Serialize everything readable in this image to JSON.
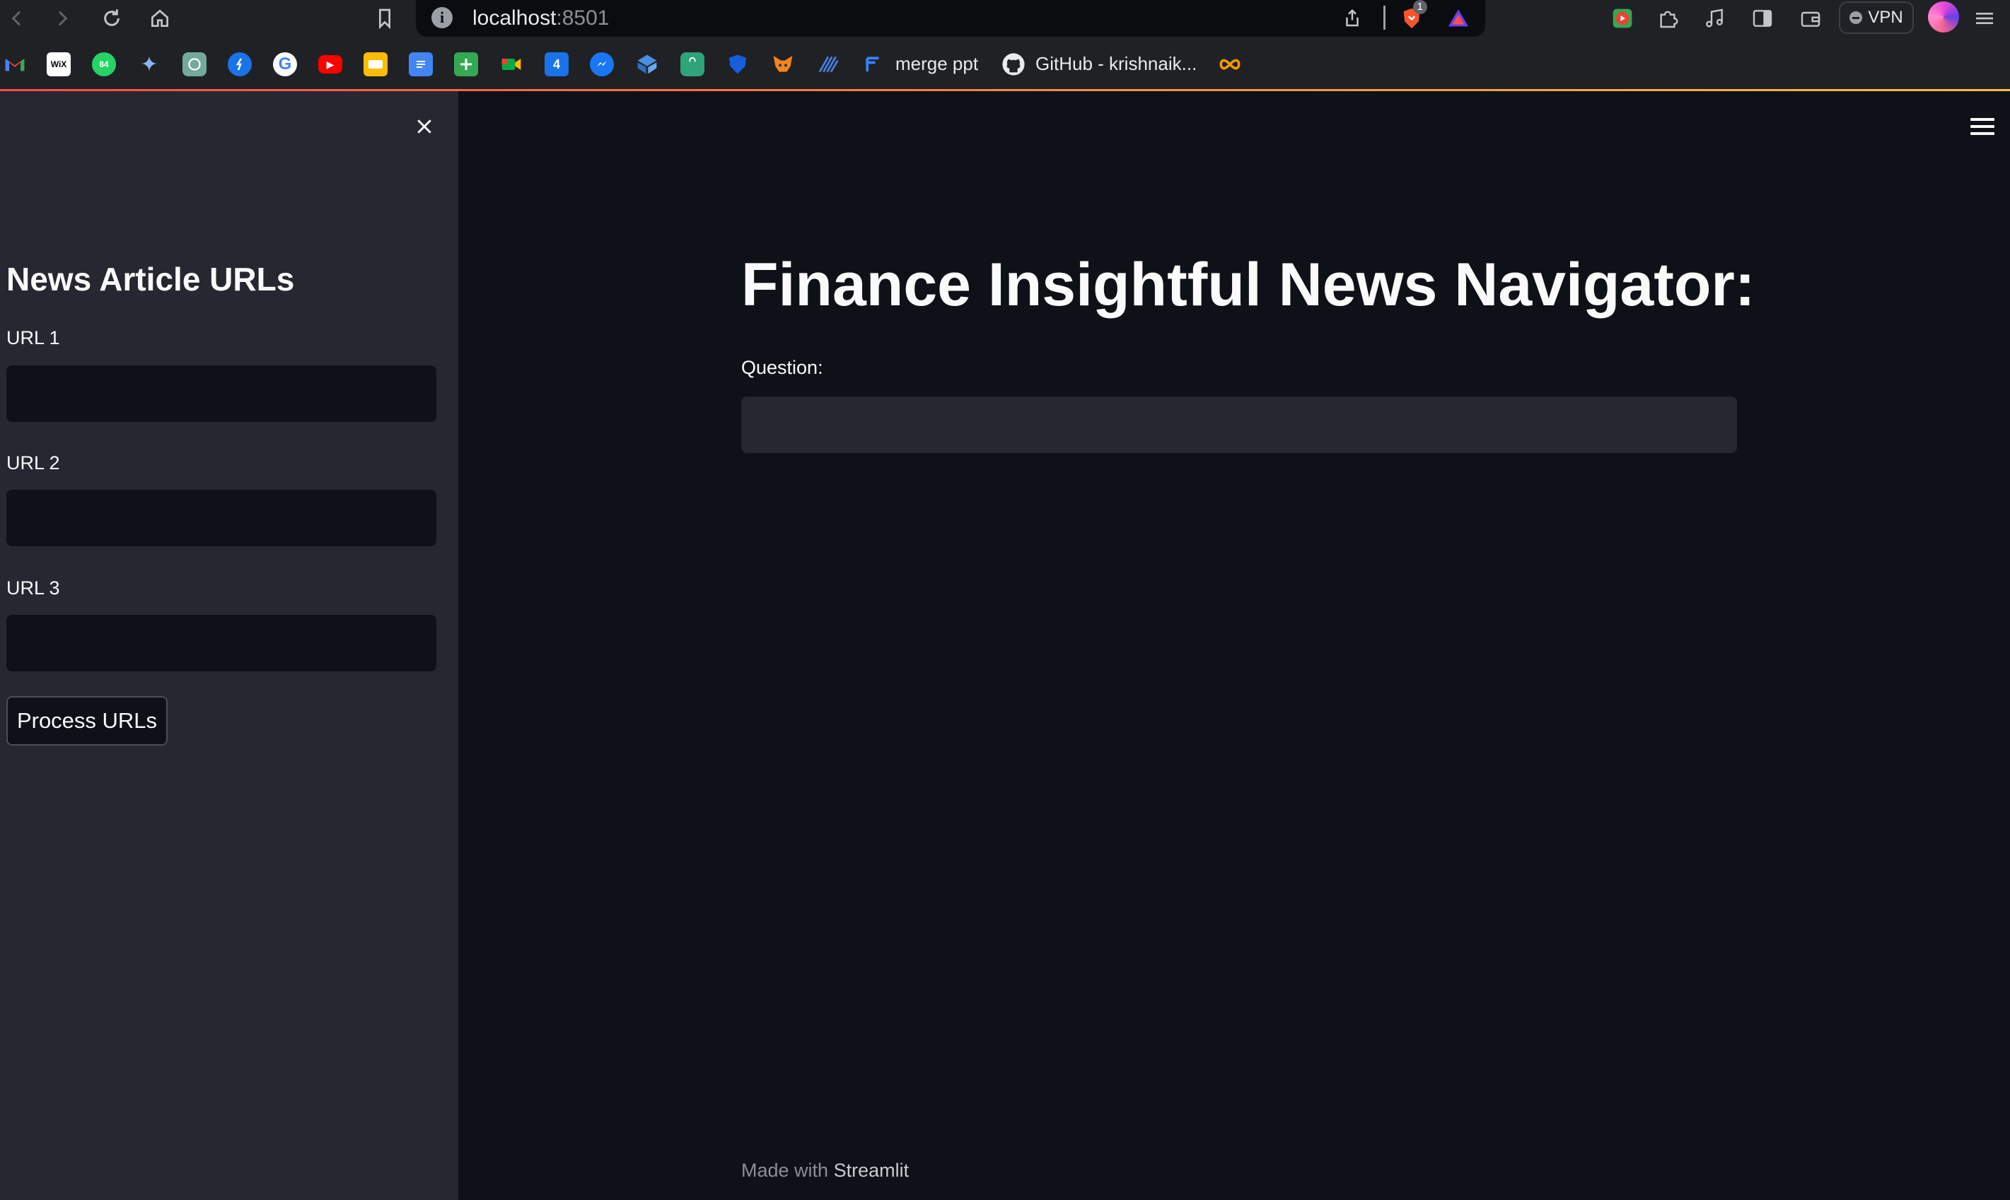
{
  "browser": {
    "address": {
      "host": "localhost",
      "port": ":8501"
    },
    "shield_badge": "1",
    "vpn_label": "VPN"
  },
  "bookmarks": [
    {
      "icon": "gmail-icon",
      "label": ""
    },
    {
      "icon": "wix-icon",
      "label": "",
      "glyph": "WiX"
    },
    {
      "icon": "whatsapp-icon",
      "label": "",
      "glyph": "84"
    },
    {
      "icon": "gemini-icon",
      "label": "",
      "glyph": "✦"
    },
    {
      "icon": "chatgpt-icon",
      "label": ""
    },
    {
      "icon": "blue-circle-icon",
      "label": ""
    },
    {
      "icon": "google-icon",
      "label": "",
      "glyph": "G"
    },
    {
      "icon": "youtube-icon",
      "label": "",
      "glyph": "▶"
    },
    {
      "icon": "google-slides-icon",
      "label": ""
    },
    {
      "icon": "google-docs-icon",
      "label": ""
    },
    {
      "icon": "google-sheets-icon",
      "label": ""
    },
    {
      "icon": "google-meet-icon",
      "label": ""
    },
    {
      "icon": "calendar-icon",
      "label": "",
      "glyph": "4"
    },
    {
      "icon": "messenger-icon",
      "label": ""
    },
    {
      "icon": "cube-icon",
      "label": ""
    },
    {
      "icon": "bag-icon",
      "label": ""
    },
    {
      "icon": "shield-icon",
      "label": ""
    },
    {
      "icon": "metamask-icon",
      "label": ""
    },
    {
      "icon": "waves-icon",
      "label": ""
    },
    {
      "icon": "merge-ppt-icon",
      "label": "merge ppt"
    },
    {
      "icon": "github-icon",
      "label": "GitHub - krishnaik..."
    },
    {
      "icon": "infinity-icon",
      "label": ""
    }
  ],
  "sidebar": {
    "title": "News Article URLs",
    "fields": [
      {
        "label": "URL 1",
        "value": ""
      },
      {
        "label": "URL 2",
        "value": ""
      },
      {
        "label": "URL 3",
        "value": ""
      }
    ],
    "button": "Process URLs"
  },
  "main": {
    "title": "Finance Insightful News Navigator:",
    "question_label": "Question:",
    "question_value": "",
    "footer_prefix": "Made with ",
    "footer_brand": "Streamlit"
  },
  "theme": {
    "background": "#0e1117",
    "sidebar_bg": "#262730",
    "accent_start": "#ff4b4b",
    "accent_end": "#ffbd45"
  }
}
